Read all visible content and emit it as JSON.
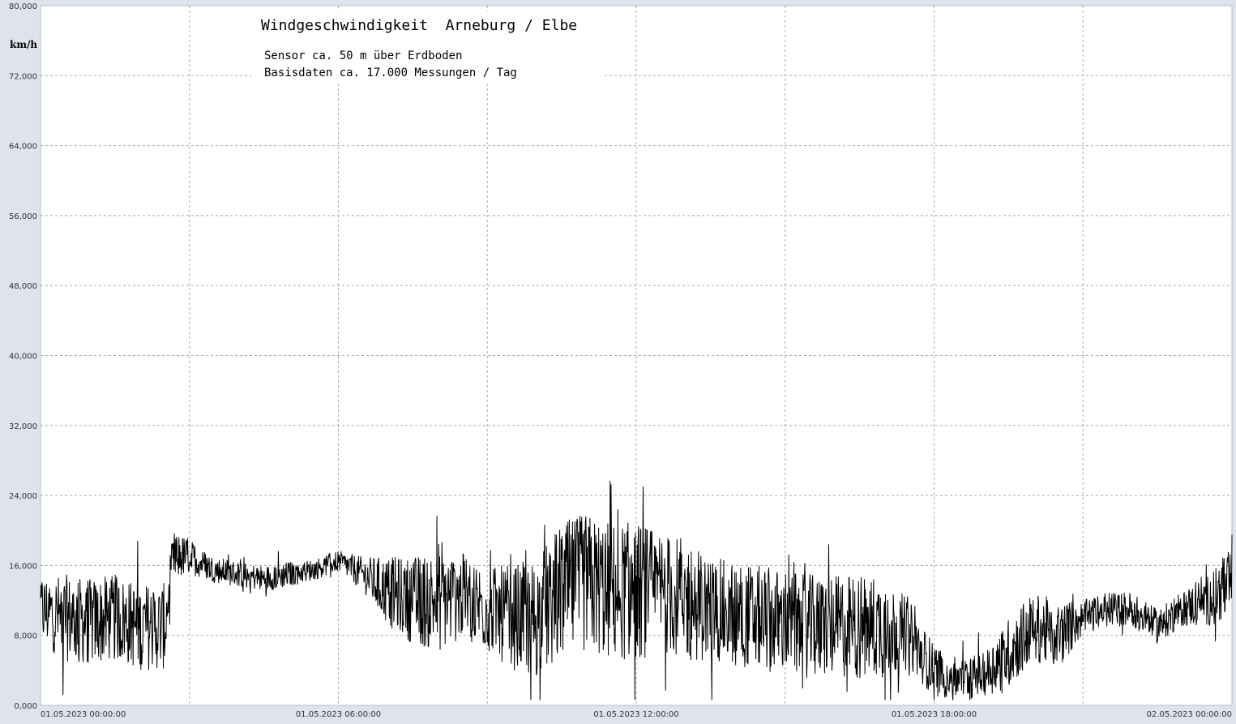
{
  "chart_data": {
    "type": "line",
    "title": "Windgeschwindigkeit  Arneburg / Elbe",
    "subtitle_lines": [
      "Sensor ca. 50 m über Erdboden",
      "Basisdaten ca. 17.000 Messungen / Tag"
    ],
    "ylabel": "km/h",
    "ylim": [
      0,
      80
    ],
    "y_tick_labels": [
      "0,000",
      "8,000",
      "16,000",
      "24,000",
      "32,000",
      "40,000",
      "48,000",
      "56,000",
      "64,000",
      "72,000",
      "80,000"
    ],
    "xlim_hours": [
      0,
      24
    ],
    "x_tick_labels": [
      {
        "hour": 0,
        "label": "01.05.2023  00:00:00"
      },
      {
        "hour": 6,
        "label": "01.05.2023  06:00:00"
      },
      {
        "hour": 12,
        "label": "01.05.2023  12:00:00"
      },
      {
        "hour": 18,
        "label": "01.05.2023  18:00:00"
      },
      {
        "hour": 24,
        "label": "02.05.2023  00:00:00"
      }
    ],
    "grid": true,
    "line_color": "#000000",
    "series": [
      {
        "x": [
          0,
          0.5,
          1,
          1.5,
          2,
          2.5,
          2.7,
          3,
          3.5,
          4,
          4.5,
          5,
          5.5,
          6,
          6.5,
          7,
          7.5,
          8,
          8.5,
          9,
          9.5,
          10,
          10.5,
          11,
          11.5,
          12,
          12.5,
          13,
          13.5,
          14,
          14.5,
          15,
          15.5,
          16,
          16.5,
          17,
          17.5,
          18,
          18.5,
          19,
          19.5,
          20,
          20.5,
          21,
          21.5,
          22,
          22.5,
          23,
          23.5,
          24
        ],
        "y": [
          11,
          10,
          9.5,
          10,
          9,
          9,
          17,
          17,
          15.5,
          15,
          14.5,
          15,
          15.5,
          16.5,
          15,
          13,
          12,
          12,
          12.5,
          11,
          10,
          10,
          13,
          14,
          13,
          13,
          13,
          12,
          11,
          10.5,
          10,
          9.5,
          9,
          9,
          9,
          9,
          8,
          4,
          3,
          3.5,
          6,
          9,
          8,
          10,
          11,
          11,
          9,
          11,
          12,
          14
        ],
        "noise_amplitude": [
          4,
          5,
          5,
          5,
          5,
          5,
          3,
          2,
          1.5,
          1.5,
          1.5,
          1.5,
          1.2,
          1.2,
          2,
          4,
          5,
          6,
          5,
          5,
          6,
          7,
          8,
          8,
          8,
          8,
          7,
          7,
          6,
          6,
          6,
          6,
          6,
          6,
          6,
          6,
          4,
          3,
          2.5,
          2.5,
          4,
          4,
          4,
          2,
          2,
          2,
          2,
          2,
          3,
          4
        ]
      }
    ]
  }
}
